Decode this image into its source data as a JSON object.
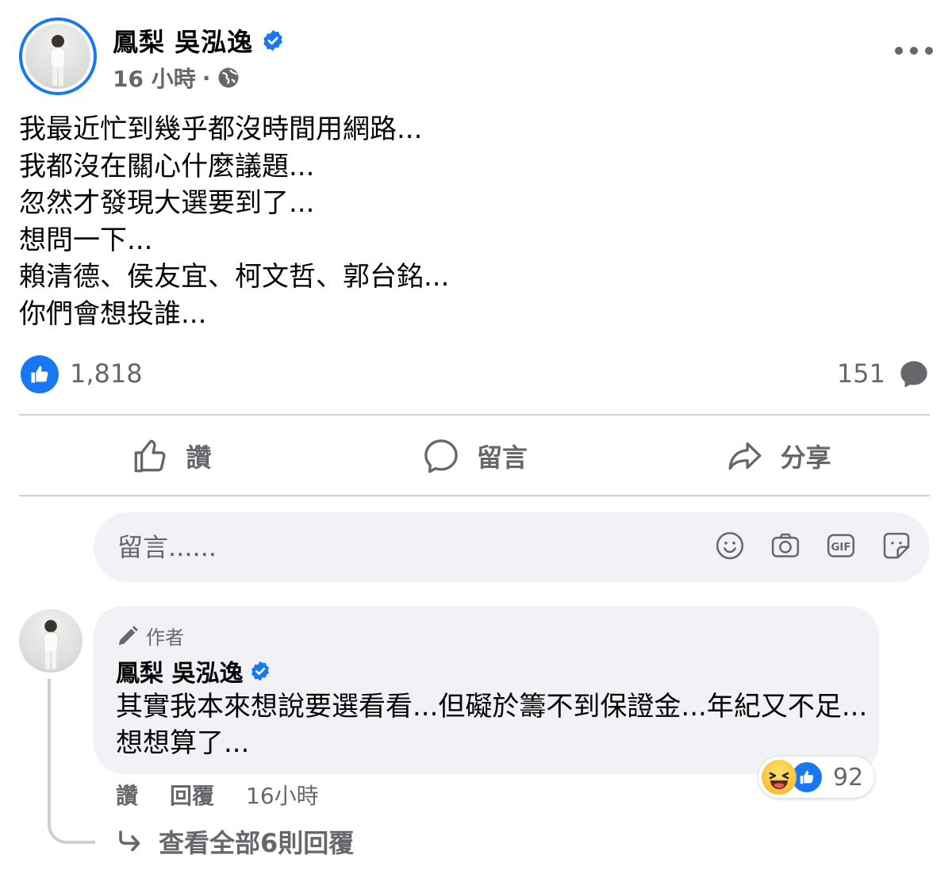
{
  "post": {
    "author": "鳳梨 吳泓逸",
    "time": "16 小時",
    "separator": "·",
    "lines": [
      "我最近忙到幾乎都沒時間用網路...",
      "我都沒在關心什麼議題...",
      "忽然才發現大選要到了...",
      "想問一下...",
      "賴清德、侯友宜、柯文哲、郭台銘...",
      "你們會想投誰..."
    ],
    "like_count": "1,818",
    "comment_count": "151"
  },
  "actions": {
    "like": "讚",
    "comment": "留言",
    "share": "分享"
  },
  "composer": {
    "placeholder": "留言......"
  },
  "comment": {
    "tag": "作者",
    "author": "鳳梨 吳泓逸",
    "text": "其實我本來想說要選看看...但礙於籌不到保證金...年紀又不足...想想算了...",
    "reaction_count": "92",
    "like": "讚",
    "reply": "回覆",
    "time": "16小時",
    "view_replies": "查看全部6則回覆"
  },
  "colors": {
    "accent": "#1877f2",
    "muted": "#65676b",
    "bubble": "#f0f2f5",
    "divider": "#ced0d4"
  },
  "icons": [
    "verified-badge-icon",
    "globe-icon",
    "more-icon",
    "like-icon",
    "comment-icon",
    "share-icon",
    "emoji-icon",
    "camera-icon",
    "gif-icon",
    "sticker-icon",
    "pencil-icon",
    "reply-arrow-icon"
  ]
}
